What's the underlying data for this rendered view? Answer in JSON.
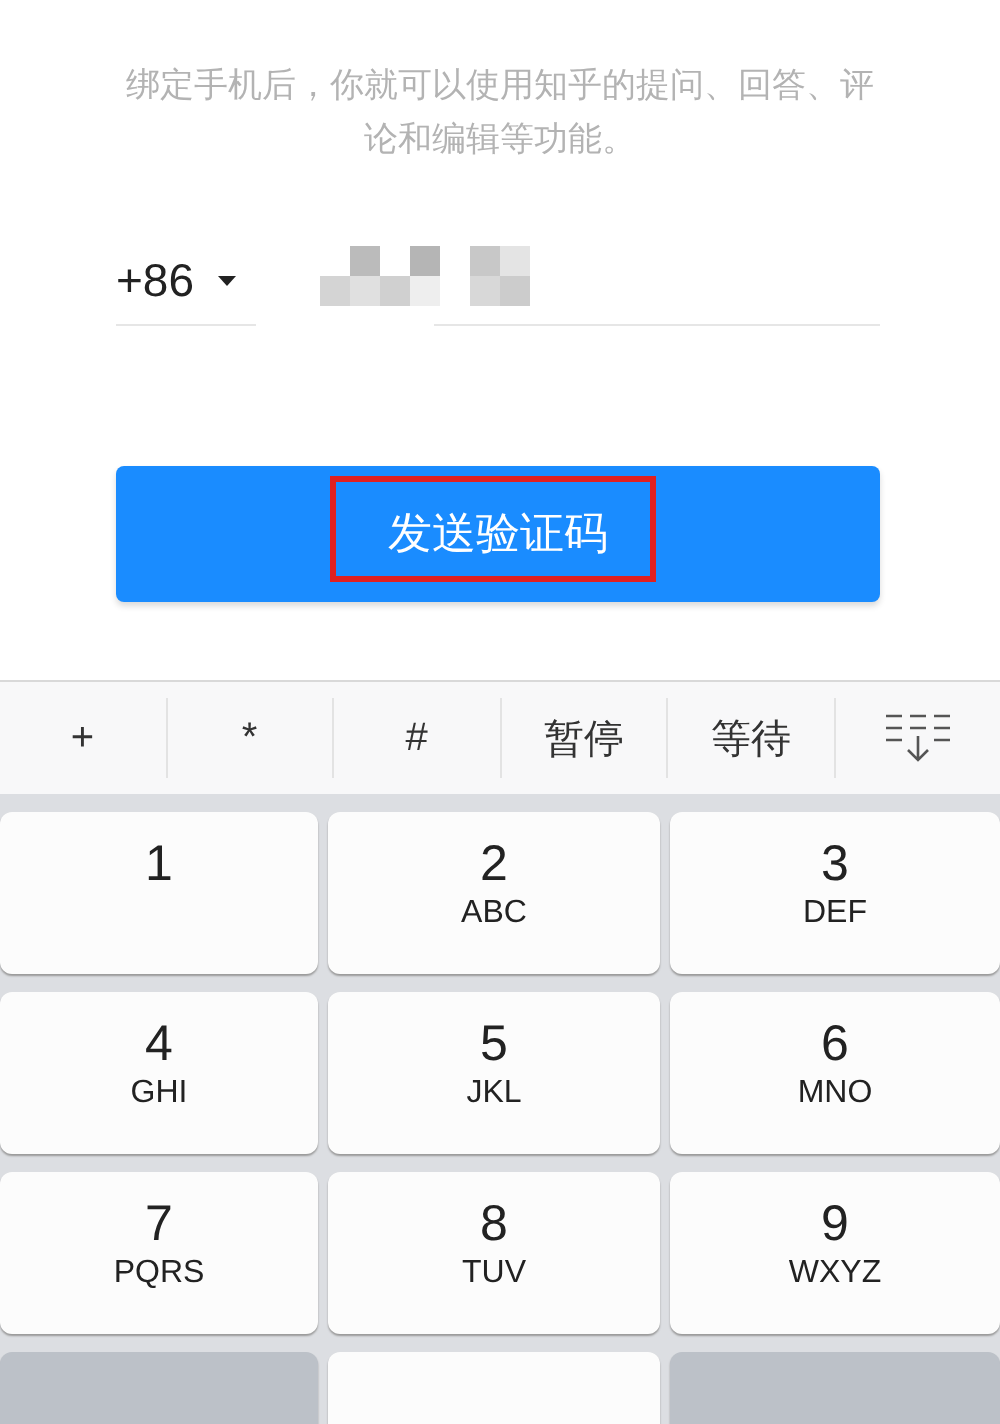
{
  "hint": "绑定手机后，你就可以使用知乎的提问、回答、评论和编辑等功能。",
  "phone": {
    "country_code": "+86",
    "number_obscured": true
  },
  "send_button": {
    "label": "发送验证码",
    "highlighted": true
  },
  "toolbar": [
    {
      "kind": "text",
      "label": "+"
    },
    {
      "kind": "text",
      "label": "*"
    },
    {
      "kind": "text",
      "label": "#"
    },
    {
      "kind": "text",
      "label": "暂停"
    },
    {
      "kind": "text",
      "label": "等待"
    },
    {
      "kind": "collapse"
    }
  ],
  "keys": [
    {
      "kind": "digit",
      "digit": "1"
    },
    {
      "kind": "digit",
      "digit": "2",
      "letters": "ABC"
    },
    {
      "kind": "digit",
      "digit": "3",
      "letters": "DEF"
    },
    {
      "kind": "digit",
      "digit": "4",
      "letters": "GHI"
    },
    {
      "kind": "digit",
      "digit": "5",
      "letters": "JKL"
    },
    {
      "kind": "digit",
      "digit": "6",
      "letters": "MNO"
    },
    {
      "kind": "digit",
      "digit": "7",
      "letters": "PQRS"
    },
    {
      "kind": "digit",
      "digit": "8",
      "letters": "TUV"
    },
    {
      "kind": "digit",
      "digit": "9",
      "letters": "WXYZ"
    },
    {
      "kind": "back"
    },
    {
      "kind": "blank"
    },
    {
      "kind": "backspace"
    }
  ]
}
